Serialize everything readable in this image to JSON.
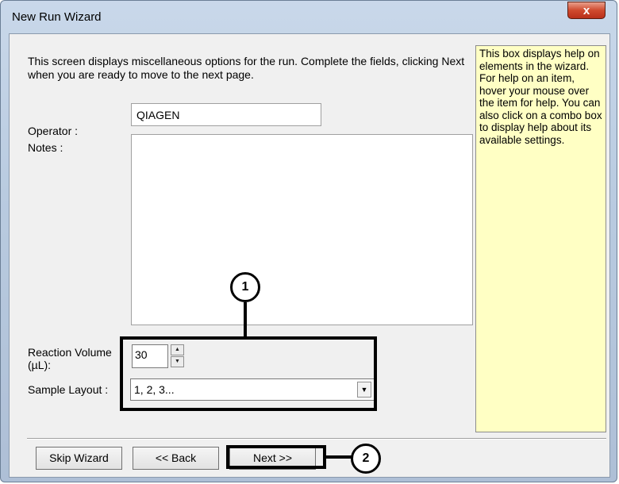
{
  "window": {
    "title": "New Run Wizard",
    "close_label": "x"
  },
  "intro_text": "This screen displays miscellaneous options for the run. Complete the fields, clicking Next when you are ready to move to the next page.",
  "operator": {
    "label": "Operator :",
    "value": "QIAGEN"
  },
  "notes": {
    "label": "Notes :",
    "value": ""
  },
  "reaction_volume": {
    "label": "Reaction Volume (µL):",
    "value": "30"
  },
  "sample_layout": {
    "label": "Sample Layout :",
    "value": "1, 2, 3..."
  },
  "help_text": "This box displays help on elements in the wizard. For help on an item, hover your mouse over the item for help. You can also click on a combo box to display help about its available settings.",
  "buttons": {
    "skip": "Skip Wizard",
    "back": "<< Back",
    "next": "Next >>"
  },
  "callouts": [
    "1",
    "2"
  ],
  "colors": {
    "help_background": "#ffffc4",
    "close_button": "#cf4a2e"
  }
}
